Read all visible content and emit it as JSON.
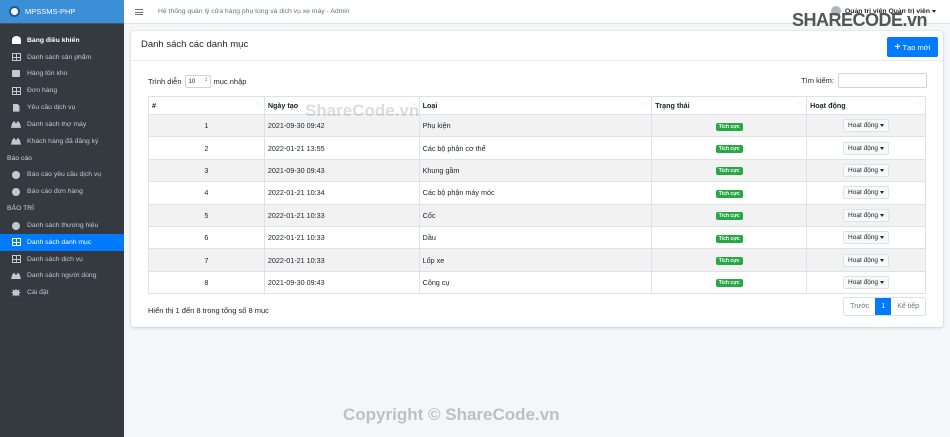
{
  "brand": {
    "name": "MPSSMS-PHP"
  },
  "topbar": {
    "title": "Hệ thống quản lý cửa hàng phụ tùng và dịch vụ xe máy - Admin",
    "user": "Quản trị viên Quản trị viên"
  },
  "sidebar": {
    "items": [
      {
        "label": "Bảng điều khiển",
        "icon": "dashboard-icon"
      },
      {
        "label": "Danh sách sản phẩm",
        "icon": "grid-icon"
      },
      {
        "label": "Hàng tồn kho",
        "icon": "box-icon"
      },
      {
        "label": "Đơn hàng",
        "icon": "grid-icon"
      },
      {
        "label": "Yêu cầu dịch vụ",
        "icon": "file-icon"
      },
      {
        "label": "Danh sách thợ máy",
        "icon": "users-icon"
      },
      {
        "label": "Khách hàng đã đăng ký",
        "icon": "users-icon"
      }
    ],
    "header_reports": "Báo cáo",
    "reports": [
      {
        "label": "Báo cáo yêu cầu dịch vụ",
        "icon": "circle-icon"
      },
      {
        "label": "Báo cáo đơn hàng",
        "icon": "circle-icon"
      }
    ],
    "header_maintenance": "BẢO TRÌ",
    "maintenance": [
      {
        "label": "Danh sách thương hiệu",
        "icon": "copyright-icon"
      },
      {
        "label": "Danh sách danh mục",
        "icon": "grid-icon"
      },
      {
        "label": "Danh sách dịch vụ",
        "icon": "grid-icon"
      },
      {
        "label": "Danh sách người dùng",
        "icon": "users-icon"
      },
      {
        "label": "Cài đặt",
        "icon": "cogs-icon"
      }
    ]
  },
  "card": {
    "title": "Danh sách các danh mục",
    "create_label": "Tạo mới",
    "length_prefix": "Trình diễn",
    "length_value": "10",
    "length_suffix": "mục nhập",
    "search_label": "Tìm kiếm:"
  },
  "table": {
    "headers": [
      "#",
      "Ngày tạo",
      "Loại",
      "Trạng thái",
      "Hoạt động"
    ],
    "rows": [
      {
        "no": "1",
        "date": "2021-09-30 09:42",
        "type": "Phụ kiện",
        "status": "Tích cực",
        "action": "Hoạt động"
      },
      {
        "no": "2",
        "date": "2022-01-21 13:55",
        "type": "Các bộ phận cơ thể",
        "status": "Tích cực",
        "action": "Hoạt động"
      },
      {
        "no": "3",
        "date": "2021-09-30 09:43",
        "type": "Khung gầm",
        "status": "Tích cực",
        "action": "Hoạt động"
      },
      {
        "no": "4",
        "date": "2022-01-21 10:34",
        "type": "Các bộ phận máy móc",
        "status": "Tích cực",
        "action": "Hoạt động"
      },
      {
        "no": "5",
        "date": "2022-01-21 10:33",
        "type": "Cốc",
        "status": "Tích cực",
        "action": "Hoạt động"
      },
      {
        "no": "6",
        "date": "2022-01-21 10:33",
        "type": "Dầu",
        "status": "Tích cực",
        "action": "Hoạt động"
      },
      {
        "no": "7",
        "date": "2022-01-21 10:33",
        "type": "Lốp xe",
        "status": "Tích cực",
        "action": "Hoạt động"
      },
      {
        "no": "8",
        "date": "2021-09-30 09:43",
        "type": "Công cụ",
        "status": "Tích cực",
        "action": "Hoạt động"
      }
    ]
  },
  "footer": {
    "info": "Hiển thị 1 đến 8 trong tổng số 8 mục",
    "prev": "Trước",
    "page": "1",
    "next": "Kế tiếp"
  },
  "watermark": {
    "center": "ShareCode.vn",
    "bottom": "Copyright © ShareCode.vn",
    "logo": "SHARECODE.vn"
  }
}
